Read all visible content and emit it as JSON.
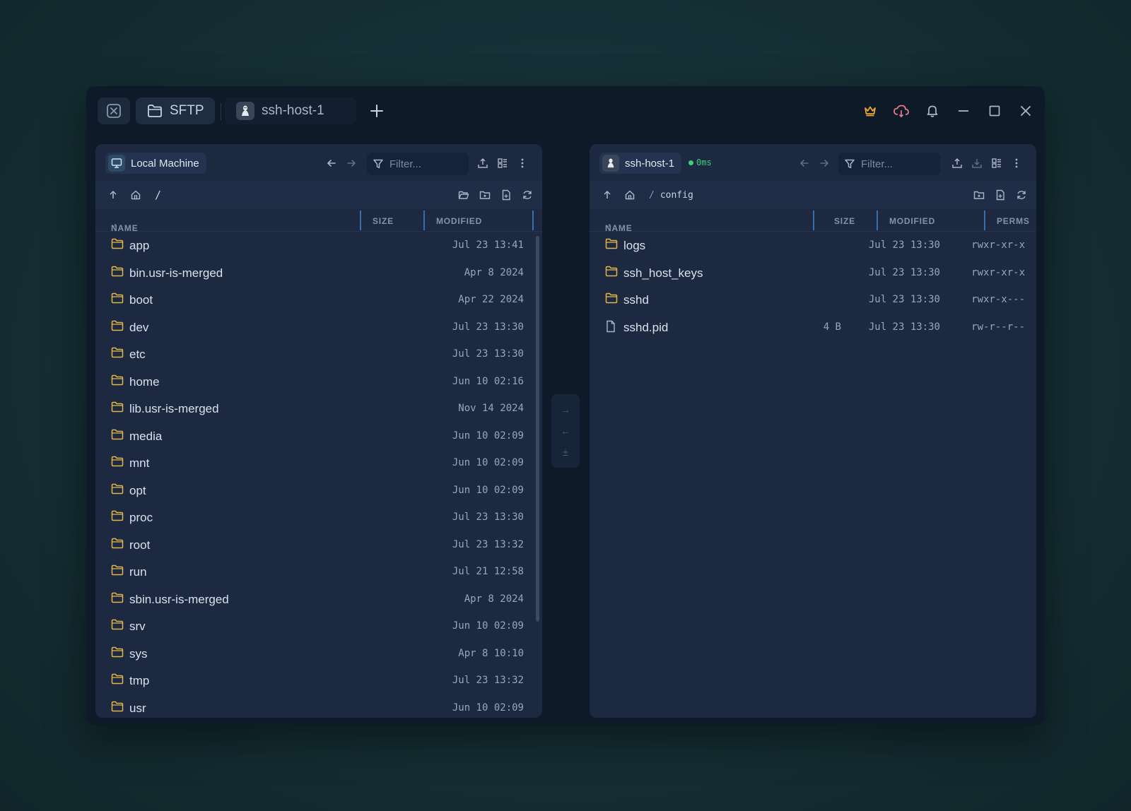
{
  "titlebar": {
    "tabs": [
      {
        "label": "SFTP",
        "icon": "folder-icon"
      },
      {
        "label": "ssh-host-1",
        "icon": "linux-icon"
      }
    ],
    "right_icons": [
      "crown-icon",
      "cloud-sync-icon",
      "bell-icon",
      "minimize-icon",
      "maximize-icon",
      "close-icon"
    ],
    "colors": {
      "crown": "#e8a53a",
      "cloud": "#e07a8a"
    }
  },
  "left_pane": {
    "machine": "Local Machine",
    "filter_placeholder": "Filter...",
    "path": "/",
    "columns": {
      "name": "NAME",
      "size": "SIZE",
      "modified": "MODIFIED"
    },
    "rows": [
      {
        "name": "app",
        "modified": "Jul 23 13:41"
      },
      {
        "name": "bin.usr-is-merged",
        "modified": "Apr 8 2024"
      },
      {
        "name": "boot",
        "modified": "Apr 22 2024"
      },
      {
        "name": "dev",
        "modified": "Jul 23 13:30"
      },
      {
        "name": "etc",
        "modified": "Jul 23 13:30"
      },
      {
        "name": "home",
        "modified": "Jun 10 02:16"
      },
      {
        "name": "lib.usr-is-merged",
        "modified": "Nov 14 2024"
      },
      {
        "name": "media",
        "modified": "Jun 10 02:09"
      },
      {
        "name": "mnt",
        "modified": "Jun 10 02:09"
      },
      {
        "name": "opt",
        "modified": "Jun 10 02:09"
      },
      {
        "name": "proc",
        "modified": "Jul 23 13:30"
      },
      {
        "name": "root",
        "modified": "Jul 23 13:32"
      },
      {
        "name": "run",
        "modified": "Jul 21 12:58"
      },
      {
        "name": "sbin.usr-is-merged",
        "modified": "Apr 8 2024"
      },
      {
        "name": "srv",
        "modified": "Jun 10 02:09"
      },
      {
        "name": "sys",
        "modified": "Apr 8 10:10"
      },
      {
        "name": "tmp",
        "modified": "Jul 23 13:32"
      },
      {
        "name": "usr",
        "modified": "Jun 10 02:09"
      }
    ]
  },
  "right_pane": {
    "machine": "ssh-host-1",
    "latency": "0ms",
    "filter_placeholder": "Filter...",
    "path_segment": "config",
    "columns": {
      "name": "NAME",
      "size": "SIZE",
      "modified": "MODIFIED",
      "perms": "PERMS"
    },
    "rows": [
      {
        "name": "logs",
        "type": "folder",
        "size": "",
        "modified": "Jul 23 13:30",
        "perms": "rwxr-xr-x"
      },
      {
        "name": "ssh_host_keys",
        "type": "folder",
        "size": "",
        "modified": "Jul 23 13:30",
        "perms": "rwxr-xr-x"
      },
      {
        "name": "sshd",
        "type": "folder",
        "size": "",
        "modified": "Jul 23 13:30",
        "perms": "rwxr-x---"
      },
      {
        "name": "sshd.pid",
        "type": "file",
        "size": "4 B",
        "modified": "Jul 23 13:30",
        "perms": "rw-r--r--"
      }
    ]
  },
  "transfer": {
    "to_remote": "→",
    "to_local": "←",
    "sync": "±"
  }
}
